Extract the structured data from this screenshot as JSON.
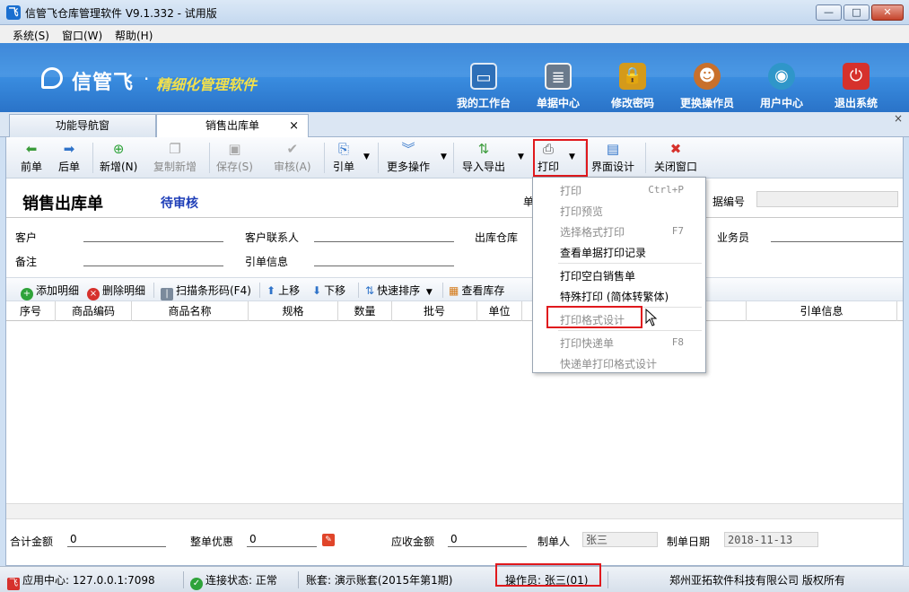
{
  "window": {
    "title": "信管飞仓库管理软件 V9.1.332 - 试用版",
    "app_icon": "app-logo-icon",
    "controls": {
      "minimize": "—",
      "maximize": "□",
      "close": "✕"
    }
  },
  "menubar": {
    "items": [
      "系统(S)",
      "窗口(W)",
      "帮助(H)"
    ]
  },
  "banner": {
    "logo_text": "信管飞",
    "logo_dot": "·",
    "slogan": "精细化管理软件",
    "nav": [
      {
        "label": "我的工作台",
        "icon": "monitor-icon",
        "color": "#2d6fb8"
      },
      {
        "label": "单据中心",
        "icon": "document-list-icon",
        "color": "#6a7a8c"
      },
      {
        "label": "修改密码",
        "icon": "lock-icon",
        "color": "#d49a1a"
      },
      {
        "label": "更换操作员",
        "icon": "user-icon",
        "color": "#c8702c"
      },
      {
        "label": "用户中心",
        "icon": "globe-icon",
        "color": "#2f96c9"
      },
      {
        "label": "退出系统",
        "icon": "power-icon",
        "color": "#d6312c"
      }
    ]
  },
  "tabs": {
    "nav": "功能导航窗",
    "active": "销售出库单",
    "close": "×",
    "panel_close": "×"
  },
  "toolbar": {
    "prev": "前单",
    "next": "后单",
    "new": "新增(N)",
    "copy_new": "复制新增",
    "save": "保存(S)",
    "review": "审核(A)",
    "reference": "引单",
    "more": "更多操作",
    "import_export": "导入导出",
    "print": "打印",
    "layout": "界面设计",
    "close_window": "关闭窗口"
  },
  "form": {
    "title": "销售出库单",
    "status": "待审核",
    "partial_label": "单",
    "docno_label": "据编号",
    "docno_value": "",
    "customer": "客户",
    "contact": "客户联系人",
    "warehouse": "出库仓库",
    "salesman": "业务员",
    "note": "备注",
    "ref_info": "引单信息"
  },
  "detailbar": {
    "add": "添加明细",
    "delete": "删除明细",
    "scan": "扫描条形码(F4)",
    "up": "上移",
    "down": "下移",
    "sort": "快速排序",
    "stock": "查看库存"
  },
  "grid": {
    "columns": [
      "序号",
      "商品编码",
      "商品名称",
      "规格",
      "数量",
      "批号",
      "单位",
      "引单信息"
    ],
    "rows": []
  },
  "totals": {
    "total_label": "合计金额",
    "total_value": "0",
    "discount_label": "整单优惠",
    "discount_value": "0",
    "receivable_label": "应收金额",
    "receivable_value": "0",
    "maker_label": "制单人",
    "maker_value": "张三",
    "date_label": "制单日期",
    "date_value": "2018-11-13"
  },
  "statusbar": {
    "app_center": "应用中心: 127.0.0.1:7098",
    "connection": "连接状态: 正常",
    "account": "账套: 演示账套(2015年第1期)",
    "operator": "操作员: 张三(01)",
    "copyright": "郑州亚拓软件科技有限公司  版权所有"
  },
  "print_menu": {
    "items": [
      {
        "label": "打印",
        "shortcut": "Ctrl+P",
        "enabled": false
      },
      {
        "label": "打印预览",
        "shortcut": "",
        "enabled": false
      },
      {
        "label": "选择格式打印",
        "shortcut": "F7",
        "enabled": false
      },
      {
        "label": "查看单据打印记录",
        "shortcut": "",
        "enabled": true
      },
      {
        "label": "打印空白销售单",
        "shortcut": "",
        "enabled": true
      },
      {
        "label": "特殊打印 (简体转繁体)",
        "shortcut": "",
        "enabled": true
      },
      {
        "label": "打印格式设计",
        "shortcut": "",
        "enabled": false
      },
      {
        "label": "打印快递单",
        "shortcut": "F8",
        "enabled": false
      },
      {
        "label": "快递单打印格式设计",
        "shortcut": "",
        "enabled": false
      }
    ]
  },
  "colors": {
    "banner": "#3b8fe2",
    "highlight": "#e0191d",
    "status_text": "#1f3fb8",
    "slogan": "#f2e04c"
  }
}
